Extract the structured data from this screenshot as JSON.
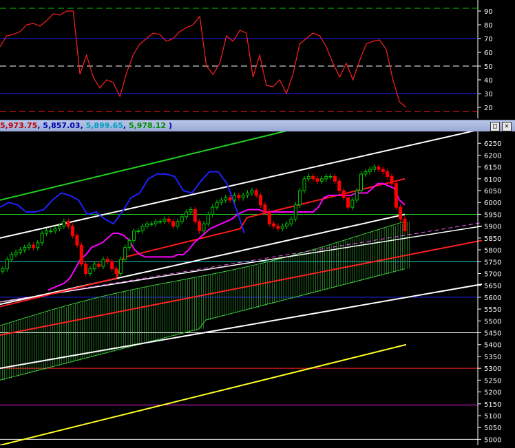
{
  "title_bar": {
    "v1": "5,973.75",
    "sep1": ", ",
    "v2": "5,857.03",
    "sep2": ", ",
    "v3": "5,899.65",
    "sep3": ", ",
    "v4": "5,978.12",
    "close_paren": " )"
  },
  "window_buttons": {
    "restore": "□",
    "close": "✕"
  },
  "colors": {
    "background": "#000000",
    "oscillator": "#ff2020",
    "price_up": "#00c800",
    "price_down": "#ff0000",
    "kijun": "#ff00ff",
    "tenkan": "#ff1a1a",
    "chikou": "#2020ff",
    "cloud": "#40d040",
    "channel": "#ffffff",
    "trend_red": "#ff2020",
    "trend_green": "#20d020",
    "trend_yellow": "#ffff20"
  },
  "chart_data": [
    {
      "type": "line",
      "panel": "oscillator",
      "ylim": [
        15,
        95
      ],
      "yticks": [
        20,
        30,
        40,
        50,
        60,
        70,
        80,
        90
      ],
      "reference_lines": [
        {
          "y": 92,
          "color": "#00c800",
          "style": "dashed"
        },
        {
          "y": 70,
          "color": "#2020ff",
          "style": "solid"
        },
        {
          "y": 50,
          "color": "#ffffff",
          "style": "dashed"
        },
        {
          "y": 30,
          "color": "#2020ff",
          "style": "solid"
        },
        {
          "y": 17,
          "color": "#ff2020",
          "style": "dashed"
        }
      ],
      "series": [
        {
          "values": [
            64,
            72,
            73,
            75,
            80,
            81,
            79,
            83,
            88,
            87,
            90,
            90,
            44,
            58,
            42,
            34,
            40,
            38,
            28,
            45,
            58,
            66,
            70,
            74,
            73,
            68,
            70,
            75,
            78,
            80,
            86,
            50,
            44,
            52,
            72,
            68,
            76,
            74,
            42,
            58,
            36,
            35,
            40,
            30,
            44,
            66,
            70,
            74,
            72,
            64,
            52,
            42,
            52,
            40,
            54,
            66,
            68,
            69,
            62,
            40,
            24,
            20
          ]
        }
      ]
    },
    {
      "type": "candlestick",
      "panel": "price",
      "ylim": [
        4975,
        6300
      ],
      "yticks": [
        5000,
        5050,
        5100,
        5150,
        5200,
        5250,
        5300,
        5350,
        5400,
        5450,
        5500,
        5550,
        5600,
        5650,
        5700,
        5750,
        5800,
        5850,
        5900,
        5950,
        6000,
        6050,
        6100,
        6150,
        6200,
        6250
      ],
      "horizontal_levels": [
        {
          "y": 5950,
          "color": "#20d020"
        },
        {
          "y": 5750,
          "color": "#20d0d0"
        },
        {
          "y": 5600,
          "color": "#2020ff"
        },
        {
          "y": 5450,
          "color": "#ffffff"
        },
        {
          "y": 5300,
          "color": "#ff2020"
        },
        {
          "y": 5145,
          "color": "#ff20ff"
        },
        {
          "y": 5000,
          "color": "#ffffff"
        }
      ],
      "candles_close": [
        5720,
        5760,
        5780,
        5790,
        5800,
        5810,
        5820,
        5810,
        5830,
        5870,
        5880,
        5880,
        5890,
        5900,
        5920,
        5900,
        5860,
        5820,
        5740,
        5700,
        5720,
        5740,
        5730,
        5760,
        5750,
        5720,
        5700,
        5760,
        5810,
        5840,
        5880,
        5880,
        5900,
        5910,
        5910,
        5920,
        5920,
        5930,
        5920,
        5900,
        5920,
        5940,
        5960,
        5970,
        5920,
        5880,
        5910,
        5950,
        5980,
        6000,
        6010,
        6020,
        6010,
        6030,
        6020,
        6030,
        6040,
        6050,
        6030,
        5990,
        5960,
        5910,
        5900,
        5890,
        5900,
        5910,
        5930,
        5990,
        6050,
        6100,
        6110,
        6100,
        6090,
        6100,
        6110,
        6110,
        6090,
        6050,
        6020,
        5980,
        6010,
        6050,
        6120,
        6130,
        6140,
        6150,
        6140,
        6130,
        6110,
        6080,
        5980,
        5930,
        5880
      ],
      "kijun": [
        5630,
        5640,
        5650,
        5660,
        5680,
        5720,
        5760,
        5780,
        5810,
        5820,
        5830,
        5850,
        5870,
        5870,
        5860,
        5840,
        5800,
        5780,
        5770,
        5770,
        5770,
        5770,
        5770,
        5770,
        5780,
        5780,
        5800,
        5830,
        5850,
        5870,
        5890,
        5900,
        5910,
        5920,
        5930,
        5950,
        5960,
        5970,
        5970,
        5970,
        5960,
        5960,
        5960,
        5960,
        5960,
        5960,
        5960,
        5960,
        5960,
        5960,
        5980,
        6020,
        6030,
        6030,
        6030,
        6030,
        6030,
        6040,
        6040,
        6040,
        6060,
        6080,
        6080,
        6070,
        6060,
        6010,
        5990
      ],
      "chikou": [
        5980,
        6000,
        5990,
        5960,
        5960,
        5970,
        6010,
        6040,
        6030,
        6010,
        5950,
        5960,
        5930,
        5910,
        5960,
        6020,
        6040,
        6100,
        6120,
        6120,
        6110,
        6050,
        6040,
        6090,
        6130,
        6130,
        6080,
        5980,
        5870
      ]
    }
  ]
}
